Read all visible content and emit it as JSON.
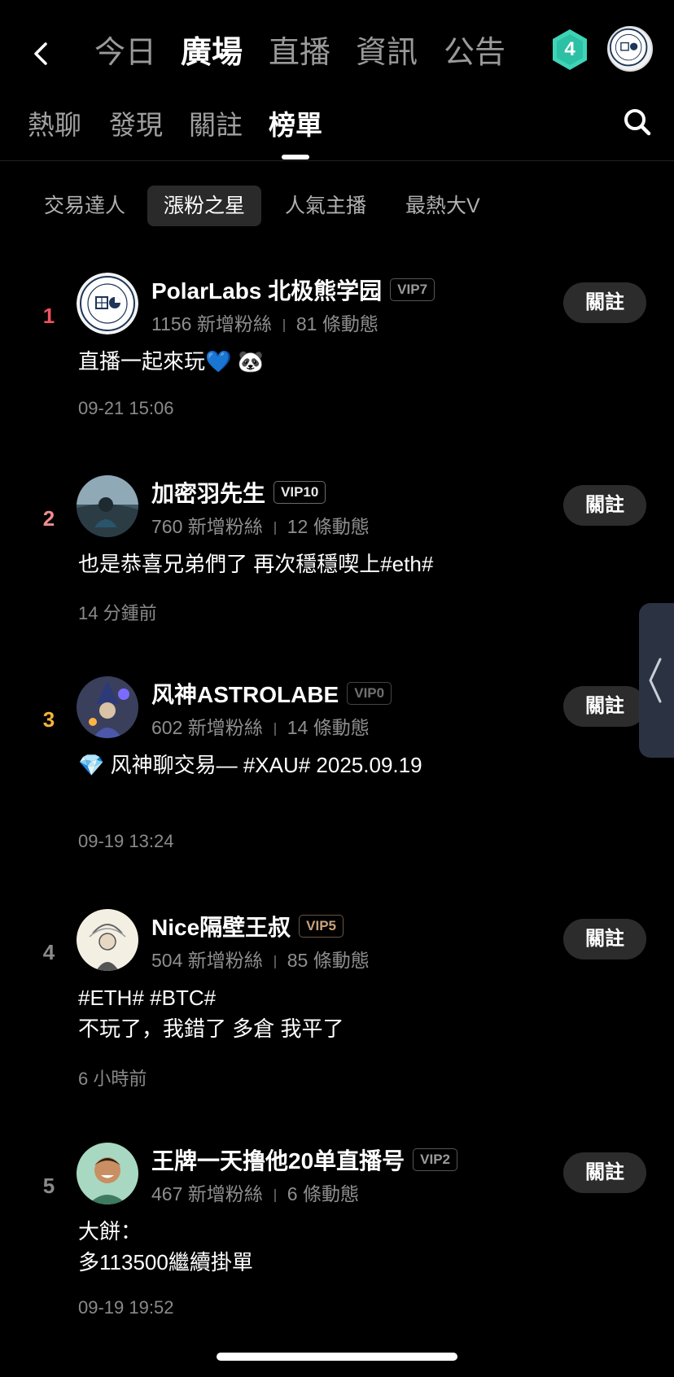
{
  "nav": {
    "back_icon": "chevron-left-icon",
    "tabs": [
      "今日",
      "廣場",
      "直播",
      "資訊",
      "公告"
    ],
    "active_tab": "廣場",
    "level_badge": "4",
    "level_badge_color": "#3fd3b8"
  },
  "subnav": {
    "tabs": [
      "熱聊",
      "發現",
      "關註",
      "榜單"
    ],
    "active_tab": "榜單",
    "search_icon": "search-icon"
  },
  "chips": [
    "交易達人",
    "漲粉之星",
    "人氣主播",
    "最熱大V"
  ],
  "active_chip": "漲粉之星",
  "rank_colors": {
    "1": "#f0525e",
    "2": "#f08b8f",
    "3": "#f5b43a",
    "4": "#8a8a8a",
    "5": "#8a8a8a"
  },
  "follow_label": "關註",
  "list": [
    {
      "rank": "1",
      "name": "PolarLabs 北极熊学园",
      "vip": "VIP7",
      "fans": "1156 新增粉絲",
      "posts": "81 條動態",
      "content": "直播一起來玩💙 🐼",
      "time": "09-21 15:06"
    },
    {
      "rank": "2",
      "name": "加密羽先生",
      "vip": "VIP10",
      "fans": "760 新增粉絲",
      "posts": "12 條動態",
      "content": "也是恭喜兄弟們了 再次穩穩喫上#eth#",
      "time": "14 分鍾前"
    },
    {
      "rank": "3",
      "name": "风神ASTROLABE",
      "vip": "VIP0",
      "fans": "602 新增粉絲",
      "posts": "14 條動態",
      "content": "💎 风神聊交易—      #XAU#   2025.09.19",
      "time": "09-19 13:24"
    },
    {
      "rank": "4",
      "name": "Nice隔壁王叔",
      "vip": "VIP5",
      "fans": "504 新增粉絲",
      "posts": "85 條動態",
      "content": "#ETH# #BTC#\n不玩了，我錯了 多倉 我平了",
      "time": "6 小時前"
    },
    {
      "rank": "5",
      "name": "王牌一天撸他20单直播号",
      "vip": "VIP2",
      "fans": "467 新增粉絲",
      "posts": "6 條動態",
      "content": "大餅：\n多113500繼續掛單",
      "time": "09-19 19:52"
    }
  ]
}
